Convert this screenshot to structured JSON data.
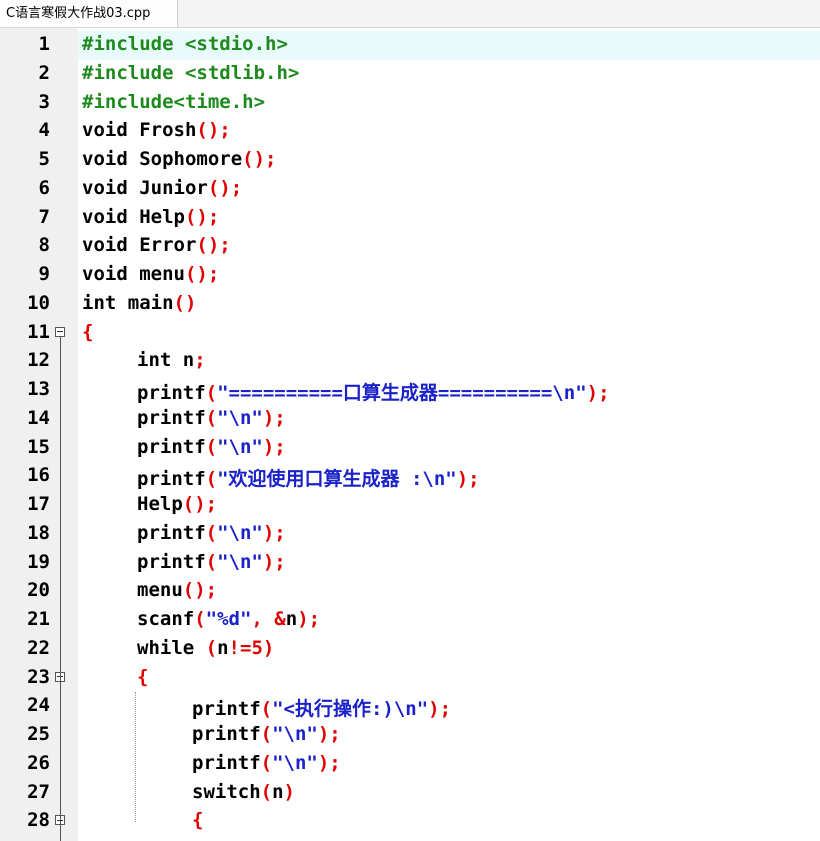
{
  "tab": {
    "title": "C语言寒假大作战03.cpp"
  },
  "editor": {
    "lines": [
      {
        "n": "1",
        "parts": [
          {
            "t": "pp",
            "v": "#include <stdio.h>"
          }
        ]
      },
      {
        "n": "2",
        "parts": [
          {
            "t": "pp",
            "v": "#include <stdlib.h>"
          }
        ]
      },
      {
        "n": "3",
        "parts": [
          {
            "t": "pp",
            "v": "#include<time.h>"
          }
        ]
      },
      {
        "n": "4",
        "parts": [
          {
            "t": "kw",
            "v": "void "
          },
          {
            "t": "id",
            "v": "Frosh"
          },
          {
            "t": "pn",
            "v": "();"
          }
        ]
      },
      {
        "n": "5",
        "parts": [
          {
            "t": "kw",
            "v": "void "
          },
          {
            "t": "id",
            "v": "Sophomore"
          },
          {
            "t": "pn",
            "v": "();"
          }
        ]
      },
      {
        "n": "6",
        "parts": [
          {
            "t": "kw",
            "v": "void "
          },
          {
            "t": "id",
            "v": "Junior"
          },
          {
            "t": "pn",
            "v": "();"
          }
        ]
      },
      {
        "n": "7",
        "parts": [
          {
            "t": "kw",
            "v": "void "
          },
          {
            "t": "id",
            "v": "Help"
          },
          {
            "t": "pn",
            "v": "();"
          }
        ]
      },
      {
        "n": "8",
        "parts": [
          {
            "t": "kw",
            "v": "void "
          },
          {
            "t": "id",
            "v": "Error"
          },
          {
            "t": "pn",
            "v": "();"
          }
        ]
      },
      {
        "n": "9",
        "parts": [
          {
            "t": "kw",
            "v": "void "
          },
          {
            "t": "id",
            "v": "menu"
          },
          {
            "t": "pn",
            "v": "();"
          }
        ]
      },
      {
        "n": "10",
        "parts": [
          {
            "t": "kw",
            "v": "int "
          },
          {
            "t": "id",
            "v": "main"
          },
          {
            "t": "pn",
            "v": "()"
          }
        ]
      },
      {
        "n": "11",
        "fold": true,
        "parts": [
          {
            "t": "pn",
            "v": "{"
          }
        ]
      },
      {
        "n": "12",
        "indent": 1,
        "parts": [
          {
            "t": "kw",
            "v": "int "
          },
          {
            "t": "id",
            "v": "n"
          },
          {
            "t": "pn",
            "v": ";"
          }
        ]
      },
      {
        "n": "13",
        "indent": 1,
        "parts": [
          {
            "t": "id",
            "v": "printf"
          },
          {
            "t": "pn",
            "v": "("
          },
          {
            "t": "st",
            "v": "\"==========口算生成器==========\\n\""
          },
          {
            "t": "pn",
            "v": ");"
          }
        ]
      },
      {
        "n": "14",
        "indent": 1,
        "parts": [
          {
            "t": "id",
            "v": "printf"
          },
          {
            "t": "pn",
            "v": "("
          },
          {
            "t": "st",
            "v": "\"\\n\""
          },
          {
            "t": "pn",
            "v": ");"
          }
        ]
      },
      {
        "n": "15",
        "indent": 1,
        "parts": [
          {
            "t": "id",
            "v": "printf"
          },
          {
            "t": "pn",
            "v": "("
          },
          {
            "t": "st",
            "v": "\"\\n\""
          },
          {
            "t": "pn",
            "v": ");"
          }
        ]
      },
      {
        "n": "16",
        "indent": 1,
        "parts": [
          {
            "t": "id",
            "v": "printf"
          },
          {
            "t": "pn",
            "v": "("
          },
          {
            "t": "st",
            "v": "\"欢迎使用口算生成器 :\\n\""
          },
          {
            "t": "pn",
            "v": ");"
          }
        ]
      },
      {
        "n": "17",
        "indent": 1,
        "parts": [
          {
            "t": "id",
            "v": "Help"
          },
          {
            "t": "pn",
            "v": "();"
          }
        ]
      },
      {
        "n": "18",
        "indent": 1,
        "parts": [
          {
            "t": "id",
            "v": "printf"
          },
          {
            "t": "pn",
            "v": "("
          },
          {
            "t": "st",
            "v": "\"\\n\""
          },
          {
            "t": "pn",
            "v": ");"
          }
        ]
      },
      {
        "n": "19",
        "indent": 1,
        "parts": [
          {
            "t": "id",
            "v": "printf"
          },
          {
            "t": "pn",
            "v": "("
          },
          {
            "t": "st",
            "v": "\"\\n\""
          },
          {
            "t": "pn",
            "v": ");"
          }
        ]
      },
      {
        "n": "20",
        "indent": 1,
        "parts": [
          {
            "t": "id",
            "v": "menu"
          },
          {
            "t": "pn",
            "v": "();"
          }
        ]
      },
      {
        "n": "21",
        "indent": 1,
        "parts": [
          {
            "t": "id",
            "v": "scanf"
          },
          {
            "t": "pn",
            "v": "("
          },
          {
            "t": "st",
            "v": "\"%d\""
          },
          {
            "t": "pn",
            "v": ", &"
          },
          {
            "t": "id",
            "v": "n"
          },
          {
            "t": "pn",
            "v": ");"
          }
        ]
      },
      {
        "n": "22",
        "indent": 1,
        "parts": [
          {
            "t": "kw",
            "v": "while "
          },
          {
            "t": "pn",
            "v": "("
          },
          {
            "t": "id",
            "v": "n"
          },
          {
            "t": "pn",
            "v": "!="
          },
          {
            "t": "cn",
            "v": "5"
          },
          {
            "t": "pn",
            "v": ")"
          }
        ]
      },
      {
        "n": "23",
        "indent": 1,
        "fold": true,
        "parts": [
          {
            "t": "pn",
            "v": "{"
          }
        ]
      },
      {
        "n": "24",
        "indent": 2,
        "parts": [
          {
            "t": "id",
            "v": "printf"
          },
          {
            "t": "pn",
            "v": "("
          },
          {
            "t": "st",
            "v": "\"<执行操作:)\\n\""
          },
          {
            "t": "pn",
            "v": ");"
          }
        ]
      },
      {
        "n": "25",
        "indent": 2,
        "parts": [
          {
            "t": "id",
            "v": "printf"
          },
          {
            "t": "pn",
            "v": "("
          },
          {
            "t": "st",
            "v": "\"\\n\""
          },
          {
            "t": "pn",
            "v": ");"
          }
        ]
      },
      {
        "n": "26",
        "indent": 2,
        "parts": [
          {
            "t": "id",
            "v": "printf"
          },
          {
            "t": "pn",
            "v": "("
          },
          {
            "t": "st",
            "v": "\"\\n\""
          },
          {
            "t": "pn",
            "v": ");"
          }
        ]
      },
      {
        "n": "27",
        "indent": 2,
        "parts": [
          {
            "t": "kw",
            "v": "switch"
          },
          {
            "t": "pn",
            "v": "("
          },
          {
            "t": "id",
            "v": "n"
          },
          {
            "t": "pn",
            "v": ")"
          }
        ]
      },
      {
        "n": "28",
        "indent": 2,
        "fold": true,
        "parts": [
          {
            "t": "pn",
            "v": "{"
          }
        ]
      }
    ]
  }
}
